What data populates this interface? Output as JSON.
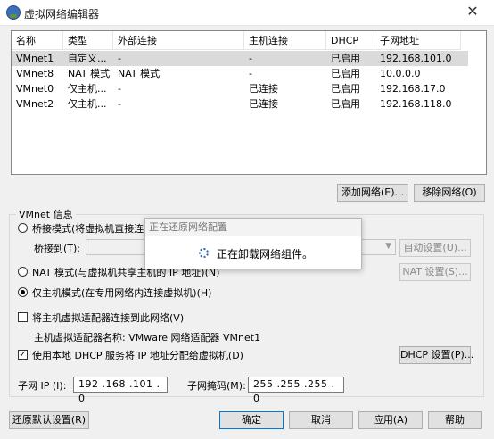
{
  "window": {
    "title": "虚拟网络编辑器",
    "close_glyph": "✕"
  },
  "table": {
    "columns": [
      "名称",
      "类型",
      "外部连接",
      "主机连接",
      "DHCP",
      "子网地址"
    ],
    "rows": [
      [
        "VMnet1",
        "自定义...",
        "-",
        "-",
        "已启用",
        "192.168.101.0"
      ],
      [
        "VMnet8",
        "NAT 模式",
        "NAT 模式",
        "-",
        "已启用",
        "10.0.0.0"
      ],
      [
        "VMnet0",
        "仅主机...",
        "-",
        "已连接",
        "已启用",
        "192.168.17.0"
      ],
      [
        "VMnet2",
        "仅主机...",
        "-",
        "已连接",
        "已启用",
        "192.168.118.0"
      ]
    ]
  },
  "buttons": {
    "add_network": "添加网络(E)...",
    "remove_network": "移除网络(O)",
    "auto_settings": "自动设置(U)...",
    "nat_settings": "NAT 设置(S)...",
    "dhcp_settings": "DHCP 设置(P)...",
    "restore_defaults": "还原默认设置(R)",
    "ok": "确定",
    "cancel": "取消",
    "apply": "应用(A)",
    "help": "帮助"
  },
  "vmnet_info": {
    "legend": "VMnet 信息",
    "bridge_mode": "桥接模式(将虚拟机直接连",
    "bridge_to_label": "桥接到(T):",
    "nat_mode": "NAT 模式(与虚拟机共享主机的 IP 地址)(N)",
    "host_only": "仅主机模式(在专用网络内连接虚拟机)(H)",
    "connect_adapter": "将主机虚拟适配器连接到此网络(V)",
    "adapter_name": "主机虚拟适配器名称: VMware 网络适配器 VMnet1",
    "use_dhcp": "使用本地 DHCP 服务将 IP 地址分配给虚拟机(D)",
    "subnet_ip_label": "子网 IP (I):",
    "subnet_ip": "192 .168 .101 . 0",
    "subnet_mask_label": "子网掩码(M):",
    "subnet_mask": "255 .255 .255 . 0"
  },
  "popup": {
    "title": "正在还原网络配置",
    "message": "正在卸载网络组件。"
  }
}
